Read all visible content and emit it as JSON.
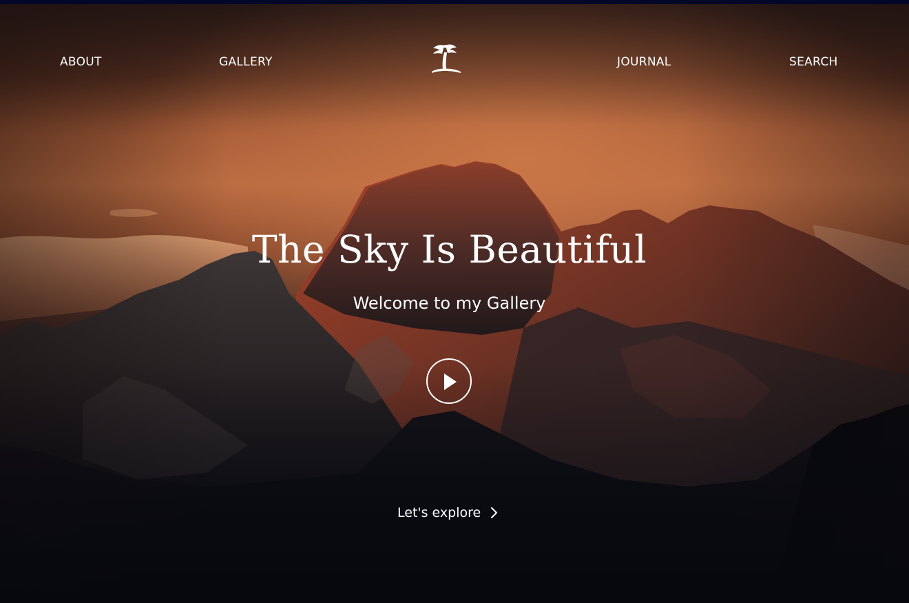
{
  "nav": {
    "about": "ABOUT",
    "gallery": "GALLERY",
    "journal": "JOURNAL",
    "search": "SEARCH",
    "logo_icon": "palm-tree-island-icon"
  },
  "hero": {
    "title": "The Sky Is Beautiful",
    "subtitle": "Welcome to my Gallery",
    "play_icon": "play-icon",
    "explore_label": "Let's explore",
    "explore_icon": "chevron-right-icon"
  },
  "colors": {
    "text": "#ffffff",
    "sky_glow": "#c97647",
    "deep_bg": "#0a0c12",
    "top_strip": "#040828"
  }
}
